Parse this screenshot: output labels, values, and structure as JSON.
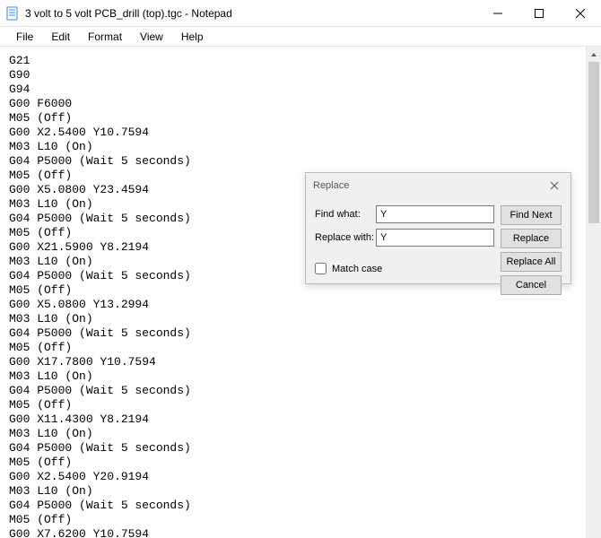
{
  "window": {
    "title": "3 volt to 5 volt PCB_drill (top).tgc - Notepad"
  },
  "menu": {
    "file": "File",
    "edit": "Edit",
    "format": "Format",
    "view": "View",
    "help": "Help"
  },
  "editor": {
    "content": "G21\nG90\nG94\nG00 F6000\nM05 (Off)\nG00 X2.5400 Y10.7594\nM03 L10 (On)\nG04 P5000 (Wait 5 seconds)\nM05 (Off)\nG00 X5.0800 Y23.4594\nM03 L10 (On)\nG04 P5000 (Wait 5 seconds)\nM05 (Off)\nG00 X21.5900 Y8.2194\nM03 L10 (On)\nG04 P5000 (Wait 5 seconds)\nM05 (Off)\nG00 X5.0800 Y13.2994\nM03 L10 (On)\nG04 P5000 (Wait 5 seconds)\nM05 (Off)\nG00 X17.7800 Y10.7594\nM03 L10 (On)\nG04 P5000 (Wait 5 seconds)\nM05 (Off)\nG00 X11.4300 Y8.2194\nM03 L10 (On)\nG04 P5000 (Wait 5 seconds)\nM05 (Off)\nG00 X2.5400 Y20.9194\nM03 L10 (On)\nG04 P5000 (Wait 5 seconds)\nM05 (Off)\nG00 X7.6200 Y10.7594"
  },
  "dialog": {
    "title": "Replace",
    "find_label": "Find what:",
    "find_value": "Y",
    "replace_label": "Replace with:",
    "replace_value": "Y",
    "match_case": "Match case",
    "btn_find_next": "Find Next",
    "btn_replace": "Replace",
    "btn_replace_all": "Replace All",
    "btn_cancel": "Cancel"
  }
}
